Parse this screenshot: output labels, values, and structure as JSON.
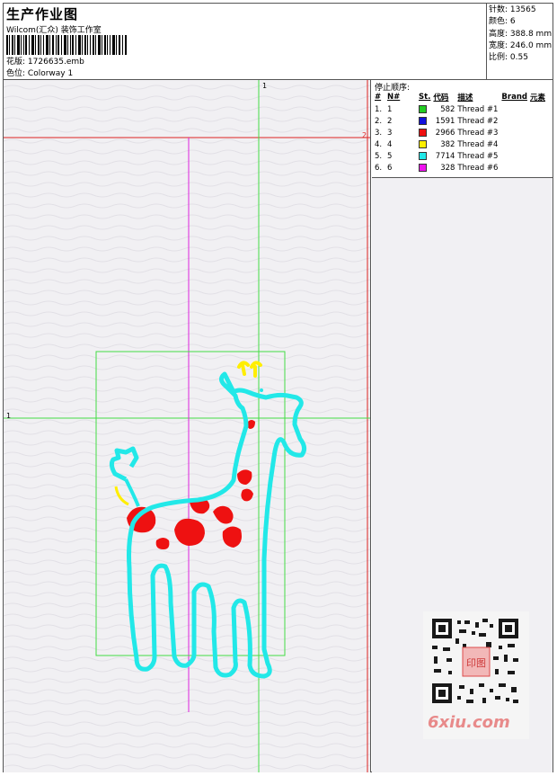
{
  "header": {
    "title": "生产作业图",
    "company": "Wilcom(汇众) 装饰工作室",
    "file_label": "花版:",
    "file_name": "1726635.emb",
    "colorway_label": "色位:",
    "colorway": "Colorway 1"
  },
  "stats": {
    "stitches_label": "针数:",
    "stitches": "13565",
    "colors_label": "颜色:",
    "colors": "6",
    "height_label": "高度:",
    "height": "388.8 mm",
    "width_label": "宽度:",
    "width": "246.0 mm",
    "scale_label": "比例:",
    "scale": "0.55"
  },
  "thread_table": {
    "title": "停止顺序:",
    "columns": [
      "#",
      "N#",
      "St.",
      "代码",
      "描述",
      "Brand",
      "元素"
    ],
    "rows": [
      {
        "num": "1.",
        "n": "1",
        "color": "#22cc22",
        "code": "582",
        "desc": "Thread #1"
      },
      {
        "num": "2.",
        "n": "2",
        "color": "#1111dd",
        "code": "1591",
        "desc": "Thread #2"
      },
      {
        "num": "3.",
        "n": "3",
        "color": "#ee1111",
        "code": "2966",
        "desc": "Thread #3"
      },
      {
        "num": "4.",
        "n": "4",
        "color": "#ffee00",
        "code": "382",
        "desc": "Thread #4"
      },
      {
        "num": "5.",
        "n": "5",
        "color": "#22e8e8",
        "code": "7714",
        "desc": "Thread #5"
      },
      {
        "num": "6.",
        "n": "6",
        "color": "#ee11ee",
        "code": "328",
        "desc": "Thread #6"
      }
    ]
  },
  "guides": {
    "label_a": "1",
    "label_b": "2",
    "label_c": "1"
  },
  "watermark": "6xiu.com",
  "qr_stamp": "印图",
  "colors": {
    "guide_green": "#44dd44",
    "guide_red": "#dd2222",
    "guide_magenta": "#dd22dd",
    "outline": "#22e8e8",
    "spots": "#ee1111",
    "horns": "#ffee00"
  }
}
